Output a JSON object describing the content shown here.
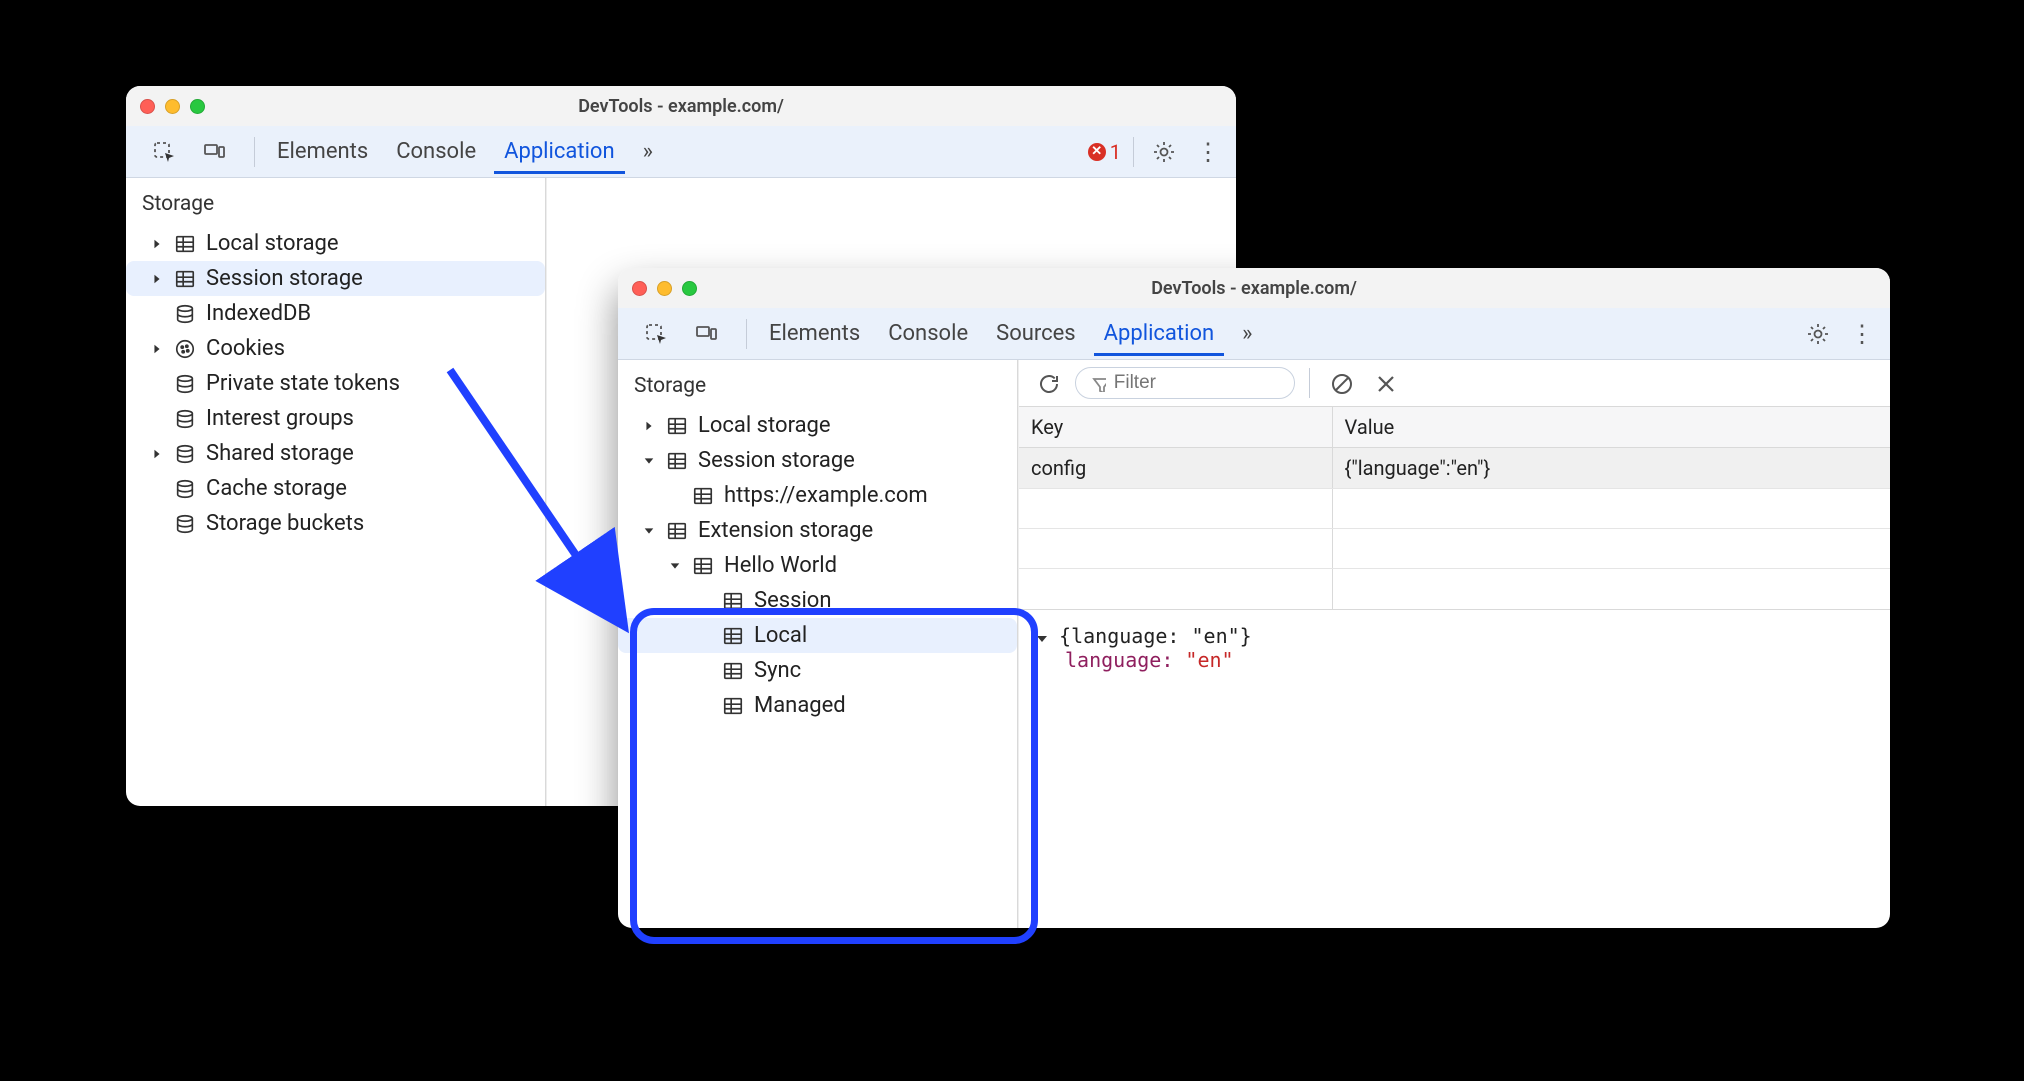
{
  "window1": {
    "title": "DevTools - example.com/",
    "tabs": [
      "Elements",
      "Console",
      "Application"
    ],
    "active_tab": "Application",
    "overflow": "»",
    "errors_count": "1",
    "sidebar": {
      "section": "Storage",
      "items": [
        {
          "label": "Local storage",
          "icon": "grid",
          "arrow": "right",
          "indent": 0
        },
        {
          "label": "Session storage",
          "icon": "grid",
          "arrow": "right",
          "indent": 0,
          "sel": true
        },
        {
          "label": "IndexedDB",
          "icon": "db",
          "arrow": "none",
          "indent": 0
        },
        {
          "label": "Cookies",
          "icon": "cookie",
          "arrow": "right",
          "indent": 0
        },
        {
          "label": "Private state tokens",
          "icon": "db",
          "arrow": "none",
          "indent": 0
        },
        {
          "label": "Interest groups",
          "icon": "db",
          "arrow": "none",
          "indent": 0
        },
        {
          "label": "Shared storage",
          "icon": "db",
          "arrow": "right",
          "indent": 0
        },
        {
          "label": "Cache storage",
          "icon": "db",
          "arrow": "none",
          "indent": 0
        },
        {
          "label": "Storage buckets",
          "icon": "db",
          "arrow": "none",
          "indent": 0
        }
      ]
    }
  },
  "window2": {
    "title": "DevTools - example.com/",
    "tabs": [
      "Elements",
      "Console",
      "Sources",
      "Application"
    ],
    "active_tab": "Application",
    "overflow": "»",
    "sidebar": {
      "section": "Storage",
      "items": [
        {
          "label": "Local storage",
          "icon": "grid",
          "arrow": "right",
          "indent": 0
        },
        {
          "label": "Session storage",
          "icon": "grid",
          "arrow": "down",
          "indent": 0
        },
        {
          "label": "https://example.com",
          "icon": "grid",
          "arrow": "none",
          "indent": 1
        },
        {
          "label": "Extension storage",
          "icon": "grid",
          "arrow": "down",
          "indent": 0
        },
        {
          "label": "Hello World",
          "icon": "grid",
          "arrow": "down",
          "indent": 1
        },
        {
          "label": "Session",
          "icon": "grid",
          "arrow": "none",
          "indent": 2
        },
        {
          "label": "Local",
          "icon": "grid",
          "arrow": "none",
          "indent": 2,
          "sel": true
        },
        {
          "label": "Sync",
          "icon": "grid",
          "arrow": "none",
          "indent": 2
        },
        {
          "label": "Managed",
          "icon": "grid",
          "arrow": "none",
          "indent": 2
        }
      ]
    },
    "detail": {
      "filter_placeholder": "Filter",
      "table_head": {
        "key": "Key",
        "value": "Value"
      },
      "rows": [
        {
          "key": "config",
          "value": "{\"language\":\"en\"}"
        }
      ],
      "json": {
        "summary": "{language: \"en\"}",
        "entry_key": "language",
        "entry_value": "\"en\""
      }
    }
  }
}
